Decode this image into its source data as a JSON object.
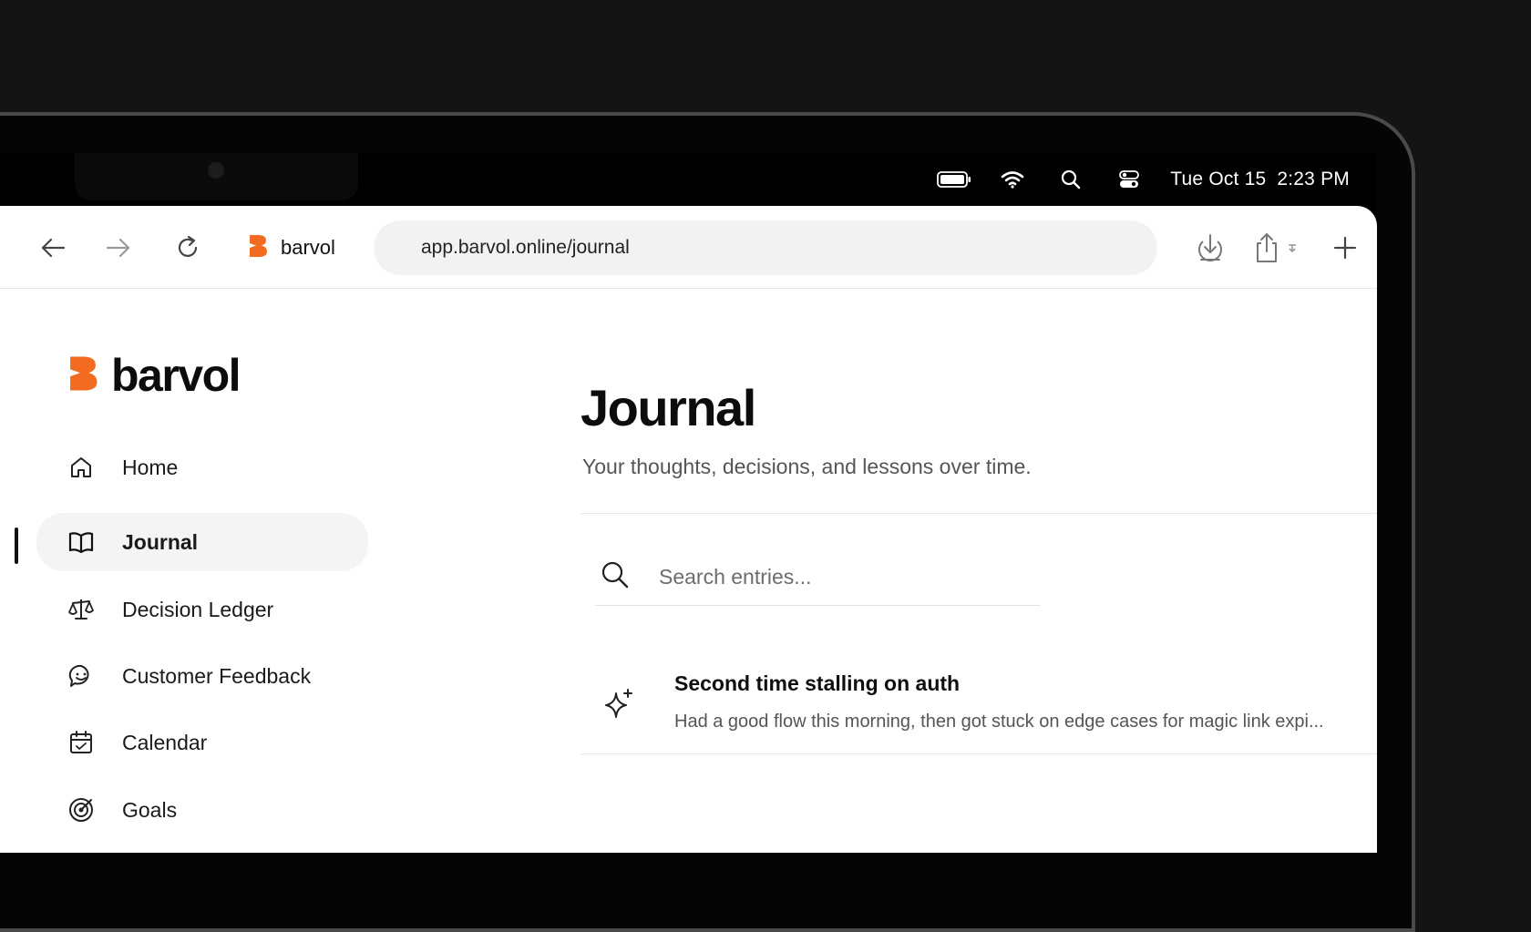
{
  "menubar": {
    "date": "Tue Oct 15",
    "time": "2:23 PM",
    "icons": [
      "battery-icon",
      "wifi-icon",
      "spotlight-search-icon",
      "control-center-icon"
    ]
  },
  "browser": {
    "tab_title": "barvol",
    "url": "app.barvol.online/journal"
  },
  "sidebar": {
    "brand": "barvol",
    "items": [
      {
        "label": "Home",
        "icon": "home-icon"
      },
      {
        "label": "Journal",
        "icon": "book-icon",
        "active": true
      },
      {
        "label": "Decision Ledger",
        "icon": "scale-icon"
      },
      {
        "label": "Customer Feedback",
        "icon": "feedback-icon"
      },
      {
        "label": "Calendar",
        "icon": "calendar-icon"
      },
      {
        "label": "Goals",
        "icon": "target-icon"
      }
    ]
  },
  "main": {
    "title": "Journal",
    "subtitle": "Your thoughts, decisions, and lessons over time.",
    "search": {
      "placeholder": "Search entries..."
    },
    "entries": [
      {
        "title": "Second time stalling on auth",
        "excerpt": "Had a good flow this morning, then got stuck on edge cases for magic link expi...",
        "icon": "sparkle-icon"
      }
    ]
  },
  "colors": {
    "brand": "#F26B21",
    "background": "#141414",
    "active_nav": "#F4F4F4"
  }
}
